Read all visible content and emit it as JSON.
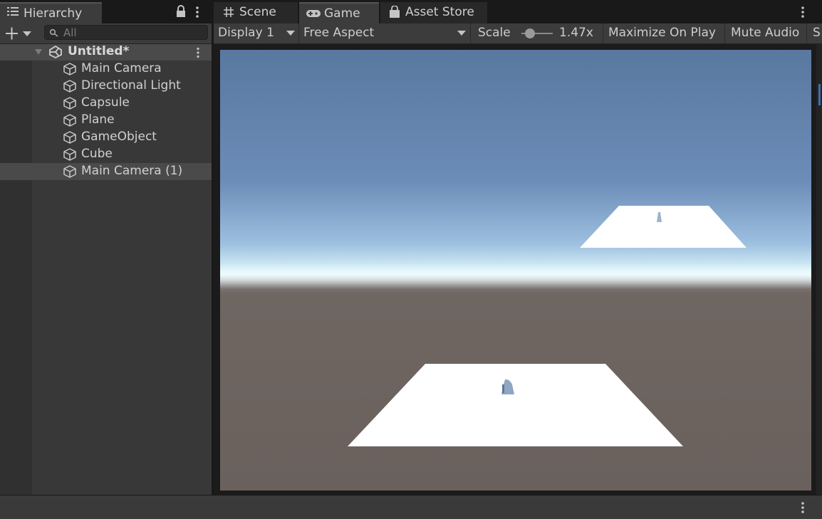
{
  "hierarchy": {
    "tab_label": "Hierarchy",
    "search_placeholder": "All",
    "scene_name": "Untitled*",
    "items": [
      {
        "label": "Main Camera"
      },
      {
        "label": "Directional Light"
      },
      {
        "label": "Capsule"
      },
      {
        "label": "Plane"
      },
      {
        "label": "GameObject"
      },
      {
        "label": "Cube"
      },
      {
        "label": "Main Camera (1)",
        "selected": true
      }
    ]
  },
  "tabs": {
    "scene": "Scene",
    "game": "Game",
    "asset_store": "Asset Store"
  },
  "game_toolbar": {
    "display": "Display 1",
    "aspect": "Free Aspect",
    "scale_label": "Scale",
    "scale_value": "1.47x",
    "maximize": "Maximize On Play",
    "mute": "Mute Audio",
    "stats_partial": "S"
  },
  "colors": {
    "panel": "#383838",
    "toolbar": "#3c3c3c",
    "selection": "#4a4a4a",
    "sky_top": "#5978a0",
    "ground": "#6a615d",
    "plane": "#ffffff"
  }
}
